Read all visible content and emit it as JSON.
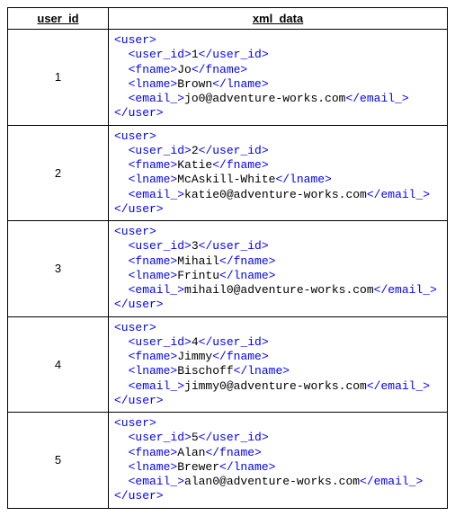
{
  "headers": {
    "user_id": "user_id",
    "xml_data": "xml_data"
  },
  "rows": [
    {
      "user_id": "1",
      "xml": {
        "open_user": "<user>",
        "indent1_uid_open": "  <user_id>",
        "uid_val": "1",
        "uid_close": "</user_id>",
        "indent1_fname_open": "  <fname>",
        "fname_val": "Jo",
        "fname_close": "</fname>",
        "indent1_lname_open": "  <lname>",
        "lname_val": "Brown",
        "lname_close": "</lname>",
        "indent1_email_open": "  <email_>",
        "email_val": "jo0@adventure-works.com",
        "email_close": "</email_>",
        "close_user": "</user>"
      }
    },
    {
      "user_id": "2",
      "xml": {
        "open_user": "<user>",
        "indent1_uid_open": "  <user_id>",
        "uid_val": "2",
        "uid_close": "</user_id>",
        "indent1_fname_open": "  <fname>",
        "fname_val": "Katie",
        "fname_close": "</fname>",
        "indent1_lname_open": "  <lname>",
        "lname_val": "McAskill-White",
        "lname_close": "</lname>",
        "indent1_email_open": "  <email_>",
        "email_val": "katie0@adventure-works.com",
        "email_close": "</email_>",
        "close_user": "</user>"
      }
    },
    {
      "user_id": "3",
      "xml": {
        "open_user": "<user>",
        "indent1_uid_open": "  <user_id>",
        "uid_val": "3",
        "uid_close": "</user_id>",
        "indent1_fname_open": "  <fname>",
        "fname_val": "Mihail",
        "fname_close": "</fname>",
        "indent1_lname_open": "  <lname>",
        "lname_val": "Frintu",
        "lname_close": "</lname>",
        "indent1_email_open": "  <email_>",
        "email_val": "mihail0@adventure-works.com",
        "email_close": "</email_>",
        "close_user": "</user>"
      }
    },
    {
      "user_id": "4",
      "xml": {
        "open_user": "<user>",
        "indent1_uid_open": "  <user_id>",
        "uid_val": "4",
        "uid_close": "</user_id>",
        "indent1_fname_open": "  <fname>",
        "fname_val": "Jimmy",
        "fname_close": "</fname>",
        "indent1_lname_open": "  <lname>",
        "lname_val": "Bischoff",
        "lname_close": "</lname>",
        "indent1_email_open": "  <email_>",
        "email_val": "jimmy0@adventure-works.com",
        "email_close": "</email_>",
        "close_user": "</user>"
      }
    },
    {
      "user_id": "5",
      "xml": {
        "open_user": "<user>",
        "indent1_uid_open": "  <user_id>",
        "uid_val": "5",
        "uid_close": "</user_id>",
        "indent1_fname_open": "  <fname>",
        "fname_val": "Alan",
        "fname_close": "</fname>",
        "indent1_lname_open": "  <lname>",
        "lname_val": "Brewer",
        "lname_close": "</lname>",
        "indent1_email_open": "  <email_>",
        "email_val": "alan0@adventure-works.com",
        "email_close": "</email_>",
        "close_user": "</user>"
      }
    }
  ]
}
